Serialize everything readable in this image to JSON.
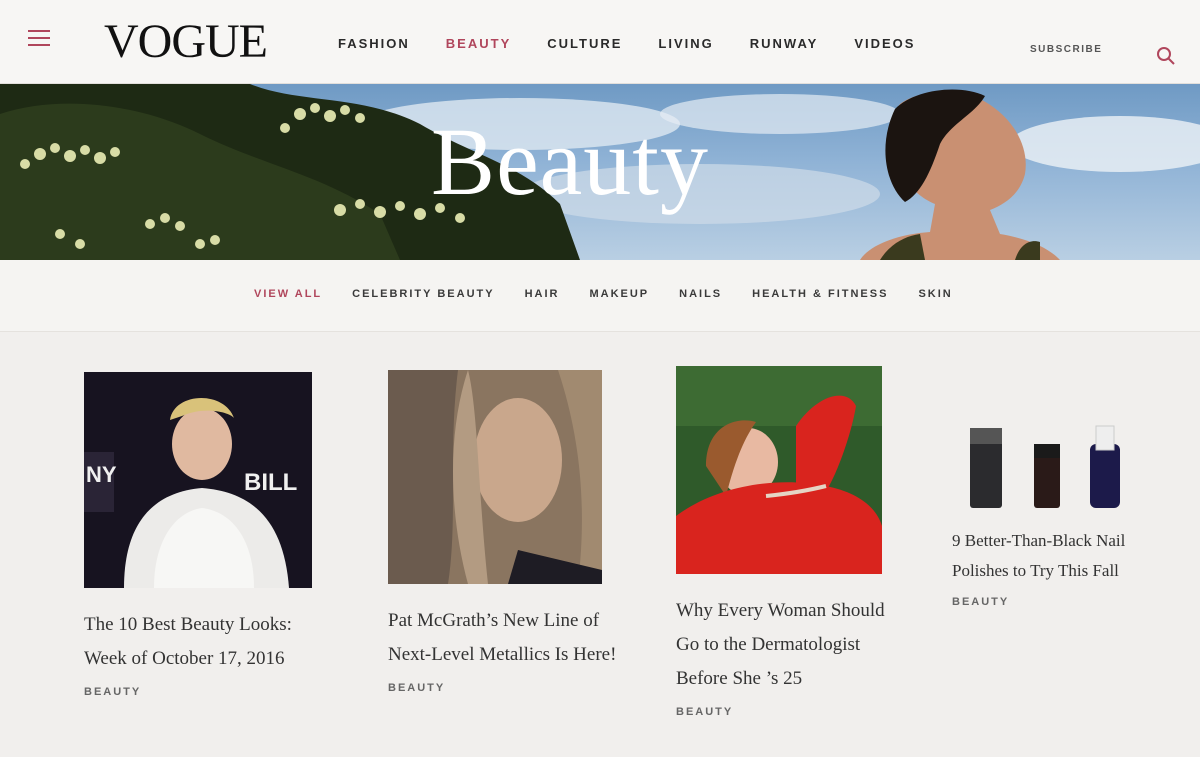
{
  "header": {
    "logo": "VOGUE",
    "nav": [
      {
        "label": "FASHION"
      },
      {
        "label": "BEAUTY",
        "active": true
      },
      {
        "label": "CULTURE"
      },
      {
        "label": "LIVING"
      },
      {
        "label": "RUNWAY"
      },
      {
        "label": "VIDEOS"
      }
    ],
    "subscribe_label": "SUBSCRIBE",
    "menu_icon": "hamburger-menu-icon",
    "search_icon": "search-icon",
    "accent_color": "#b0465c"
  },
  "hero": {
    "title": "Beauty"
  },
  "subnav": {
    "items": [
      {
        "label": "VIEW ALL",
        "active": true
      },
      {
        "label": "CELEBRITY BEAUTY"
      },
      {
        "label": "HAIR"
      },
      {
        "label": "MAKEUP"
      },
      {
        "label": "NAILS"
      },
      {
        "label": "HEALTH & FITNESS"
      },
      {
        "label": "SKIN"
      }
    ]
  },
  "articles": [
    {
      "headline": "The 10 Best Beauty Looks: Week of October 17, 2016",
      "tag": "BEAUTY"
    },
    {
      "headline": "Pat McGrath’s New Line of Next-Level Metallics Is Here!",
      "tag": "BEAUTY"
    },
    {
      "headline": "Why Every Woman Should Go to the Dermatologist Before She ’s 25",
      "tag": "BEAUTY"
    },
    {
      "headline": "9 Better-Than-Black Nail Polishes to Try This Fall",
      "tag": "BEAUTY"
    }
  ]
}
